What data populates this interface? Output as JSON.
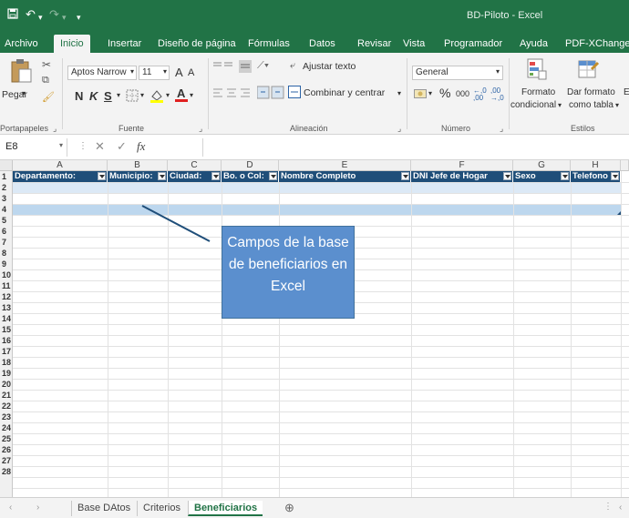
{
  "titlebar": {
    "save_icon": "save-icon",
    "undo_icon": "undo-icon",
    "redo_icon": "redo-icon",
    "title": "BD-Piloto  -  Excel",
    "accent_color": "#217346"
  },
  "ribbon_tabs": [
    {
      "label": "Archivo"
    },
    {
      "label": "Inicio"
    },
    {
      "label": "Insertar"
    },
    {
      "label": "Diseño de página"
    },
    {
      "label": "Fórmulas"
    },
    {
      "label": "Datos"
    },
    {
      "label": "Revisar"
    },
    {
      "label": "Vista"
    },
    {
      "label": "Programador"
    },
    {
      "label": "Ayuda"
    },
    {
      "label": "PDF-XChange"
    }
  ],
  "ribbon": {
    "clipboard": {
      "paste_label": "Pegar",
      "group_label": "Portapapeles"
    },
    "font": {
      "font_name": "Aptos Narrow",
      "font_size": "11",
      "grow_label": "A",
      "shrink_label": "A",
      "bold": "N",
      "italic": "K",
      "underline": "S",
      "group_label": "Fuente"
    },
    "alignment": {
      "wrap_label": "Ajustar texto",
      "merge_label": "Combinar y centrar",
      "group_label": "Alineación"
    },
    "number": {
      "format_value": "General",
      "percent": "%",
      "thousands": "000",
      "inc_decimals": "←,0 ,00",
      "dec_decimals": ",00 →,0",
      "group_label": "Número"
    },
    "styles": {
      "conditional_label_1": "Formato",
      "conditional_label_2": "condicional",
      "table_label_1": "Dar formato",
      "table_label_2": "como tabla",
      "extra_label": "E",
      "group_label": "Estilos"
    }
  },
  "formula_bar": {
    "cell_reference": "E8",
    "cancel_symbol": "✕",
    "enter_symbol": "✓",
    "fx_symbol": "fx",
    "value": ""
  },
  "grid": {
    "columns": [
      "A",
      "B",
      "C",
      "D",
      "E",
      "F",
      "G",
      "H"
    ],
    "rows": [
      "1",
      "2",
      "3",
      "4",
      "5",
      "6",
      "7",
      "8",
      "9",
      "10",
      "11",
      "12",
      "13",
      "14",
      "15",
      "16",
      "17",
      "18",
      "19",
      "20",
      "21",
      "22",
      "23",
      "24",
      "25",
      "26",
      "27",
      "28"
    ],
    "headers": [
      "Departamento:",
      "Municipio:",
      "Ciudad:",
      "Bo. o Col:",
      "Nombre Completo",
      "DNI Jefe de Hogar",
      "Sexo",
      "Telefono"
    ],
    "header_color": "#1f4e79",
    "band_color": "#bdd7ee"
  },
  "callout": {
    "text": "Campos de la base de beneficiarios en Excel",
    "color": "#5b8fce"
  },
  "sheet_tabs": [
    {
      "label": "Base DAtos"
    },
    {
      "label": "Criterios"
    },
    {
      "label": "Beneficiarios"
    }
  ],
  "add_sheet_symbol": "⊕"
}
